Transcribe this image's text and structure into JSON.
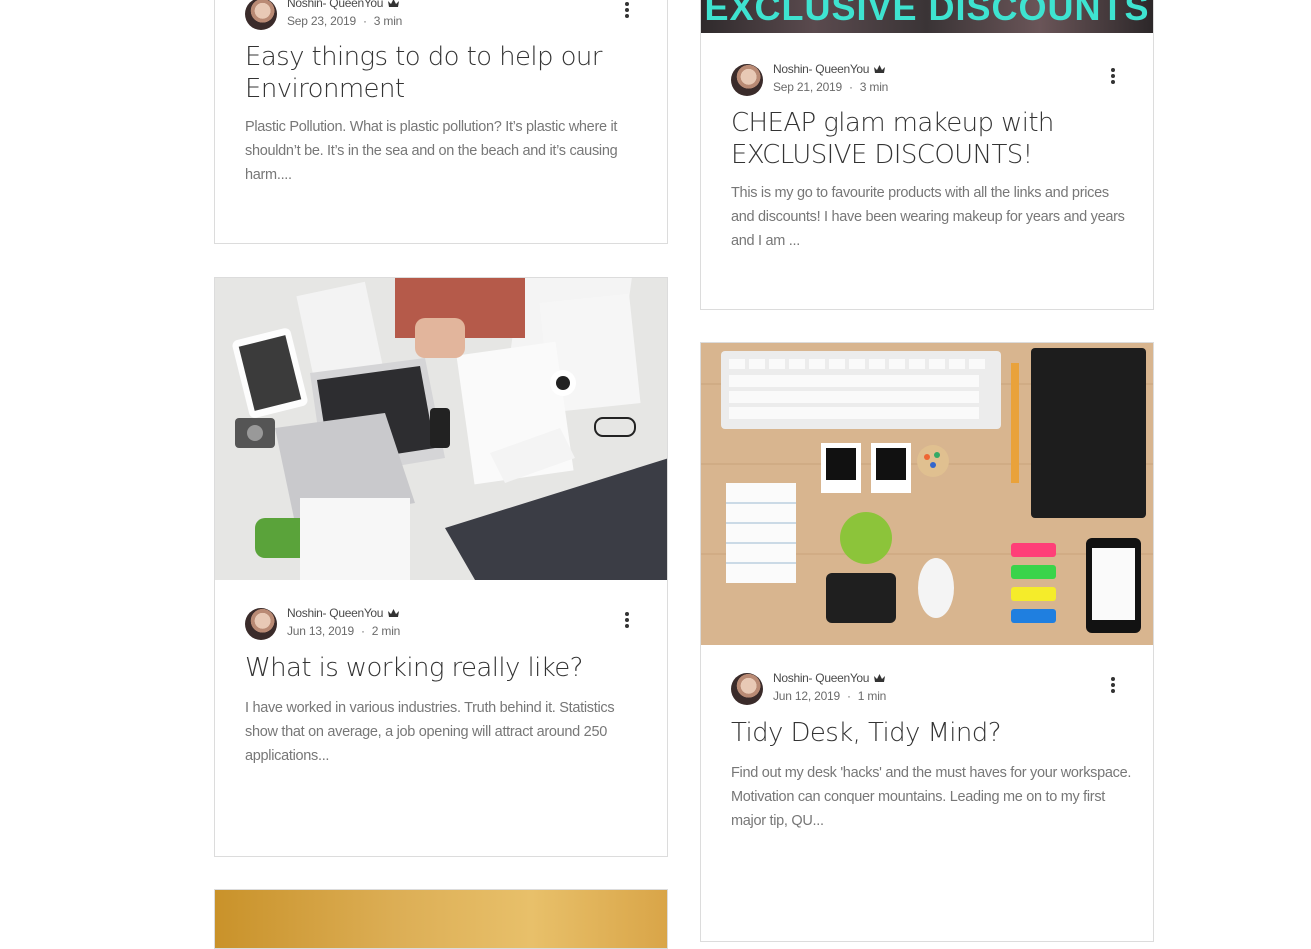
{
  "posts": [
    {
      "author": "Noshin- QueenYou",
      "date": "Sep 23, 2019",
      "read_time": "3 min",
      "title": "Easy things to do to help our Environment",
      "excerpt": "Plastic Pollution. What is plastic pollution? It’s plastic where it shouldn’t be. It’s in the sea and on the beach and it’s causing harm...."
    },
    {
      "author": "Noshin- QueenYou",
      "date": "Sep 21, 2019",
      "read_time": "3 min",
      "title": "CHEAP glam makeup with EXCLUSIVE DISCOUNTS!",
      "excerpt": "This is my go to favourite products with all the links and prices and discounts! I have been wearing makeup for years and years and I am ...",
      "image_caption": "EXCLUSIVE DISCOUNTS"
    },
    {
      "author": "Noshin- QueenYou",
      "date": "Jun 13, 2019",
      "read_time": "2 min",
      "title": "What is working really like?",
      "excerpt": "I have worked in various industries. Truth behind it. Statistics show that on average, a job opening will attract around 250 applications..."
    },
    {
      "author": "Noshin- QueenYou",
      "date": "Jun 12, 2019",
      "read_time": "1 min",
      "title": "Tidy Desk, Tidy Mind?",
      "excerpt": "Find out my desk 'hacks' and the must haves for your workspace. Motivation can conquer mountains. Leading me on to my first major tip, QU..."
    }
  ],
  "icons": {
    "admin_badge": "crown-icon",
    "more_actions": "more-vertical-icon"
  },
  "colors": {
    "text": "#333333",
    "excerpt": "#777777",
    "border": "#dcdcdc",
    "banner_text": "#3ee3d0"
  }
}
